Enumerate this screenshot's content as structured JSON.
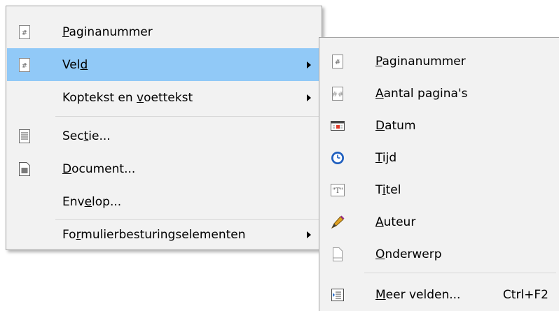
{
  "main_menu": {
    "items": [
      {
        "icon": "page-number-icon",
        "pre": "",
        "acc": "P",
        "post": "aginanummer"
      },
      {
        "icon": "field-icon",
        "pre": "Vel",
        "acc": "d",
        "post": "",
        "submenu": true,
        "highlighted": true
      },
      {
        "icon": "",
        "pre": "Koptekst en ",
        "acc": "v",
        "post": "oettekst",
        "submenu": true
      },
      {
        "icon": "section-icon",
        "pre": "Sec",
        "acc": "t",
        "post": "ie..."
      },
      {
        "icon": "document-icon",
        "pre": "",
        "acc": "D",
        "post": "ocument..."
      },
      {
        "icon": "",
        "pre": "Env",
        "acc": "e",
        "post": "lop..."
      },
      {
        "icon": "",
        "pre": "Fo",
        "acc": "r",
        "post": "mulierbesturingselementen",
        "submenu": true
      }
    ]
  },
  "sub_menu": {
    "items": [
      {
        "icon": "page-number-icon",
        "pre": "",
        "acc": "P",
        "post": "aginanummer"
      },
      {
        "icon": "page-count-icon",
        "pre": "",
        "acc": "A",
        "post": "antal pagina's"
      },
      {
        "icon": "date-icon",
        "pre": "",
        "acc": "D",
        "post": "atum"
      },
      {
        "icon": "clock-icon",
        "pre": "",
        "acc": "T",
        "post": "ijd"
      },
      {
        "icon": "title-icon",
        "pre": "T",
        "acc": "i",
        "post": "tel"
      },
      {
        "icon": "author-pen-icon",
        "pre": "",
        "acc": "A",
        "post": "uteur"
      },
      {
        "icon": "subject-icon",
        "pre": "",
        "acc": "O",
        "post": "nderwerp"
      },
      {
        "icon": "more-fields-icon",
        "pre": "",
        "acc": "M",
        "post": "eer velden...",
        "shortcut": "Ctrl+F2"
      }
    ]
  },
  "colors": {
    "highlight": "#91c9f7",
    "menu_bg": "#f2f2f2",
    "border": "#a0a0a0",
    "clock_blue": "#1f5fbf"
  }
}
